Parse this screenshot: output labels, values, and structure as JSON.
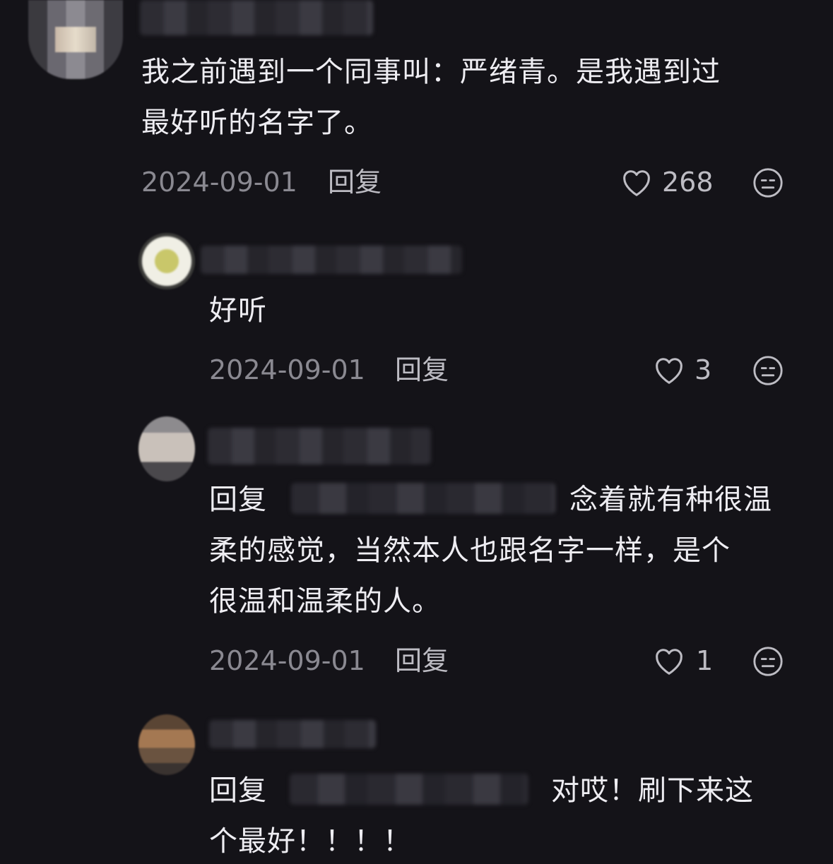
{
  "comments": [
    {
      "text_line1": "我之前遇到一个同事叫：严绪青。是我遇到过",
      "text_line2": "最好听的名字了。",
      "date": "2024-09-01",
      "reply_label": "回复",
      "likes": "268"
    },
    {
      "text": "好听",
      "date": "2024-09-01",
      "reply_label": "回复",
      "likes": "3"
    },
    {
      "reply_prefix": "回复",
      "text_line1": "念着就有种很温",
      "text_line2": "柔的感觉，当然本人也跟名字一样，是个",
      "text_line3": "很温和温柔的人。",
      "date": "2024-09-01",
      "reply_label": "回复",
      "likes": "1"
    },
    {
      "reply_prefix": "回复",
      "text_line1": "对哎！刷下来这",
      "text_line2": "个最好！！！！"
    }
  ],
  "icons": {
    "like": "heart-outline-icon",
    "dislike": "meh-face-icon"
  },
  "colors": {
    "background": "#141318",
    "text": "#eeedf2",
    "meta": "#8a8991"
  }
}
